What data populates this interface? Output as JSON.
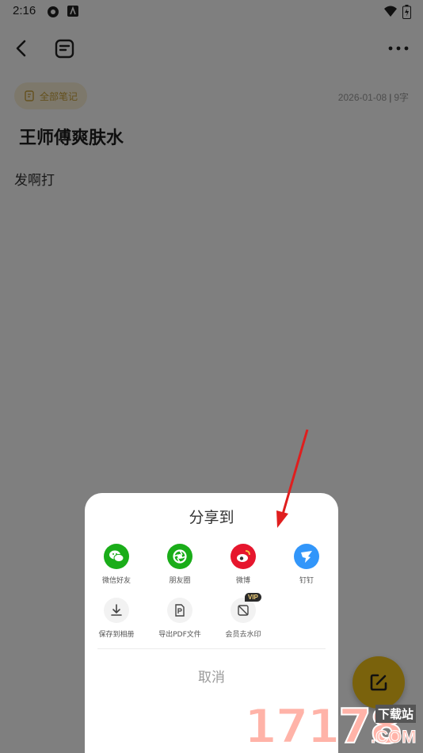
{
  "status_bar": {
    "time": "2:16"
  },
  "note": {
    "category_chip": "全部笔记",
    "date": "2026-01-08",
    "word_count": "9字",
    "title": "王师傅爽肤水",
    "body": "发啊打"
  },
  "share_sheet": {
    "title": "分享到",
    "targets": [
      {
        "label": "微信好友",
        "icon": "wechat-icon",
        "color": "#1aad19"
      },
      {
        "label": "朋友圈",
        "icon": "moments-icon",
        "color": "#1aad19"
      },
      {
        "label": "微博",
        "icon": "weibo-icon",
        "color": "#e6162d"
      },
      {
        "label": "钉钉",
        "icon": "dingtalk-icon",
        "color": "#3296fa"
      }
    ],
    "actions": [
      {
        "label": "保存到相册",
        "icon": "download-icon"
      },
      {
        "label": "导出PDF文件",
        "icon": "pdf-export-icon"
      },
      {
        "label": "会员去水印",
        "icon": "watermark-remove-icon",
        "badge": "VIP"
      }
    ],
    "cancel_label": "取消"
  },
  "watermark": {
    "numbers": "17178",
    "site": "下载站",
    "domain": ".COM"
  }
}
